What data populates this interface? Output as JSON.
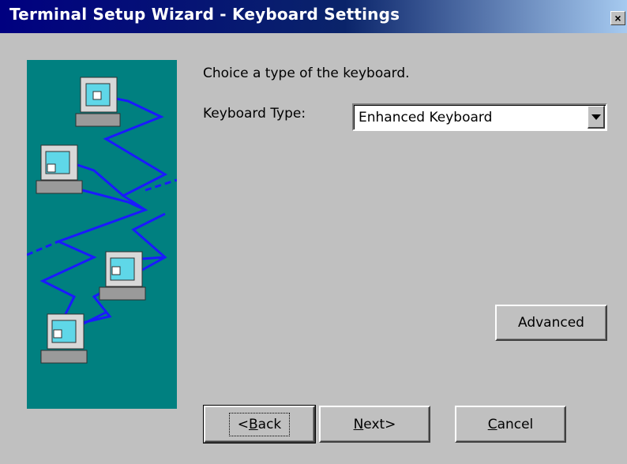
{
  "window": {
    "title": "Terminal Setup Wizard - Keyboard Settings",
    "close_glyph": "×"
  },
  "content": {
    "instruction": "Choice a type of the keyboard.",
    "keyboard_type_label": "Keyboard Type:",
    "keyboard_type_value": "Enhanced Keyboard"
  },
  "buttons": {
    "advanced": "Advanced",
    "back_prefix": "<",
    "back_accel": "B",
    "back_rest": "ack",
    "next_accel": "N",
    "next_rest": "ext>",
    "cancel_accel": "C",
    "cancel_rest": "ancel"
  },
  "colors": {
    "titlebar_start": "#000080",
    "titlebar_end": "#a6caf0",
    "dialog_bg": "#c0c0c0",
    "illustration_bg": "#008080",
    "network_lines": "#1a1aff"
  },
  "icons": {
    "illustration": "networked-computers-illustration",
    "close": "close-icon",
    "dropdown": "chevron-down-icon"
  }
}
